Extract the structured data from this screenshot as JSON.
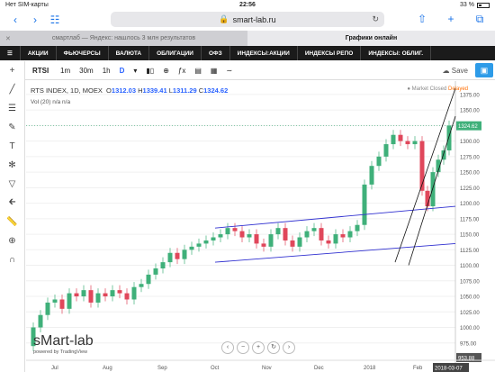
{
  "status": {
    "carrier": "Нет SIM-карты",
    "time": "22:56",
    "battery": "33 %"
  },
  "browser": {
    "url": "smart-lab.ru",
    "tab1": "смартлаб — Яндекс: нашлось 3 млн результатов",
    "tab2": "Графики онлайн"
  },
  "menu": [
    "АКЦИИ",
    "ФЬЮЧЕРСЫ",
    "ВАЛЮТА",
    "ОБЛИГАЦИИ",
    "ОФЗ",
    "ИНДЕКСЫ:АКЦИИ",
    "ИНДЕКСЫ РЕПО",
    "ИНДЕКСЫ: ОБЛИГ."
  ],
  "toolbar": {
    "symbol": "RTSI",
    "intervals": [
      "1m",
      "30m",
      "1h",
      "D"
    ],
    "save": "Save"
  },
  "legend": {
    "name": "RTS INDEX, 1D, MOEX",
    "o": "1312.03",
    "h": "1339.41",
    "l": "1311.29",
    "c": "1324.62",
    "vol": "Vol (20)",
    "vol_vals": "n/a  n/a"
  },
  "market": {
    "closed": "Market Closed",
    "delayed": "Delayed"
  },
  "branding": {
    "logo": "sMart-lab",
    "powered": "powered by TradingView"
  },
  "chart_data": {
    "type": "candlestick",
    "x_labels": [
      "Jul",
      "Aug",
      "Sep",
      "Oct",
      "Nov",
      "Dec",
      "2018",
      "Feb",
      "2018-03-07"
    ],
    "y_ticks": [
      1375,
      1350,
      1325,
      1300,
      1275,
      1250,
      1225,
      1200,
      1175,
      1150,
      1125,
      1100,
      1075,
      1050,
      1025,
      1000,
      975,
      953.88
    ],
    "last_price_label": "1324.62",
    "low_label": "953.88",
    "ylim": [
      950,
      1385
    ]
  }
}
